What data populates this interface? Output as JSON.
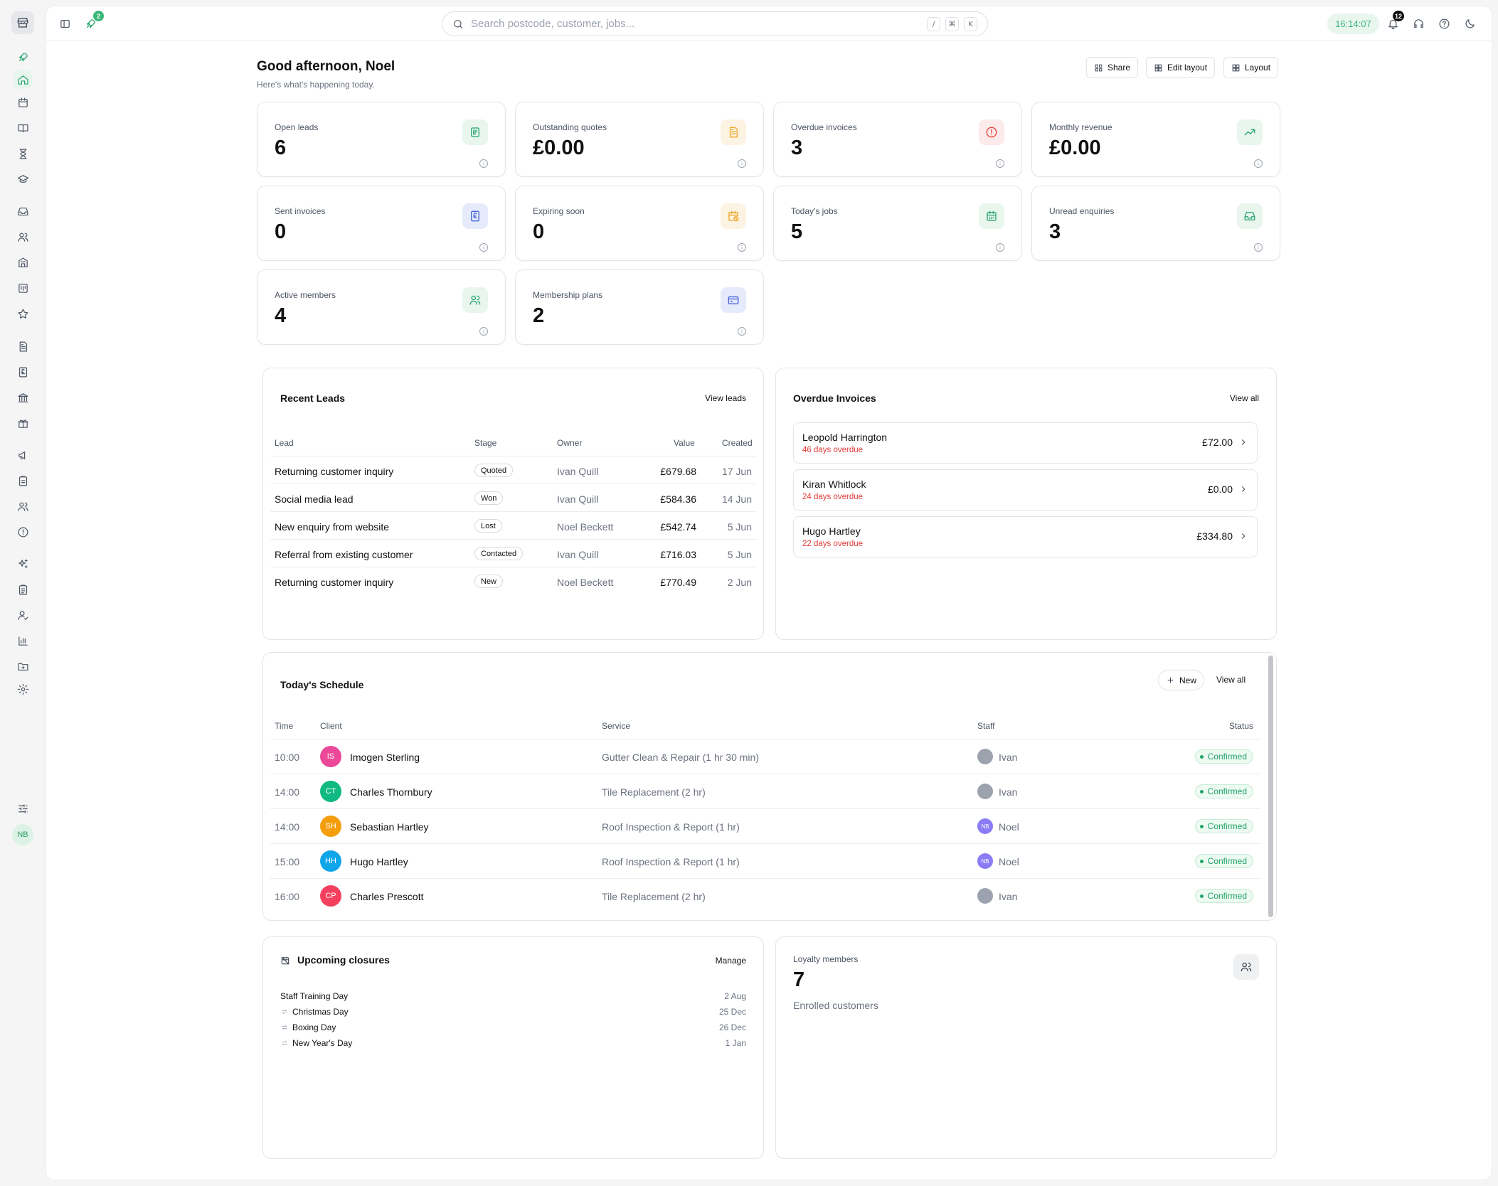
{
  "topbar": {
    "search_placeholder": "Search postcode, customer, jobs...",
    "kbd_slash": "/",
    "kbd_cmd": "⌘",
    "kbd_k": "K",
    "clock": "16:14:07",
    "rocket_badge": "2",
    "notification_badge": "12"
  },
  "header": {
    "greeting": "Good afternoon, Noel",
    "subtitle": "Here's what's happening today.",
    "share_label": "Share",
    "edit_layout_label": "Edit layout",
    "layout_label": "Layout"
  },
  "stats": [
    {
      "label": "Open leads",
      "value": "6",
      "icon": "clipboard-icon",
      "color": "#22a36a"
    },
    {
      "label": "Outstanding quotes",
      "value": "£0.00",
      "icon": "document-icon",
      "color": "#e9a21a"
    },
    {
      "label": "Overdue invoices",
      "value": "3",
      "icon": "alert-icon",
      "color": "#e23b3b"
    },
    {
      "label": "Monthly revenue",
      "value": "£0.00",
      "icon": "trend-up-icon",
      "color": "#22a36a"
    },
    {
      "label": "Sent invoices",
      "value": "0",
      "icon": "invoice-pound-icon",
      "color": "#3b5bdb"
    },
    {
      "label": "Expiring soon",
      "value": "0",
      "icon": "calendar-clock-icon",
      "color": "#e9a21a"
    },
    {
      "label": "Today's jobs",
      "value": "5",
      "icon": "calendar-icon",
      "color": "#22a36a"
    },
    {
      "label": "Unread enquiries",
      "value": "3",
      "icon": "inbox-icon",
      "color": "#22a36a"
    },
    {
      "label": "Active members",
      "value": "4",
      "icon": "users-icon",
      "color": "#22a36a"
    },
    {
      "label": "Membership plans",
      "value": "2",
      "icon": "credit-card-icon",
      "color": "#3b5bdb"
    }
  ],
  "recent_leads": {
    "title": "Recent Leads",
    "link": "View leads",
    "columns": [
      "Lead",
      "Stage",
      "Owner",
      "Value",
      "Created"
    ],
    "rows": [
      {
        "lead": "Returning customer inquiry",
        "stage": "Quoted",
        "owner": "Ivan Quill",
        "value": "£679.68",
        "created": "17 Jun"
      },
      {
        "lead": "Social media lead",
        "stage": "Won",
        "owner": "Ivan Quill",
        "value": "£584.36",
        "created": "14 Jun"
      },
      {
        "lead": "New enquiry from website",
        "stage": "Lost",
        "owner": "Noel Beckett",
        "value": "£542.74",
        "created": "5 Jun"
      },
      {
        "lead": "Referral from existing customer",
        "stage": "Contacted",
        "owner": "Ivan Quill",
        "value": "£716.03",
        "created": "5 Jun"
      },
      {
        "lead": "Returning customer inquiry",
        "stage": "New",
        "owner": "Noel Beckett",
        "value": "£770.49",
        "created": "2 Jun"
      }
    ]
  },
  "overdue_invoices": {
    "title": "Overdue Invoices",
    "link": "View all",
    "items": [
      {
        "name": "Leopold Harrington",
        "overdue": "46 days overdue",
        "amount": "£72.00"
      },
      {
        "name": "Kiran Whitlock",
        "overdue": "24 days overdue",
        "amount": "£0.00"
      },
      {
        "name": "Hugo Hartley",
        "overdue": "22 days overdue",
        "amount": "£334.80"
      }
    ]
  },
  "schedule": {
    "title": "Today's Schedule",
    "new_label": "New",
    "link": "View all",
    "columns": [
      "Time",
      "Client",
      "Service",
      "Staff",
      "Status"
    ],
    "rows": [
      {
        "time": "10:00",
        "initials": "IS",
        "color": "#ec4899",
        "client": "Imogen Sterling",
        "service": "Gutter Clean & Repair (1 hr 30 min)",
        "staff": "Ivan",
        "staff_initials": "",
        "status": "Confirmed"
      },
      {
        "time": "14:00",
        "initials": "CT",
        "color": "#10b981",
        "client": "Charles Thornbury",
        "service": "Tile Replacement (2 hr)",
        "staff": "Ivan",
        "staff_initials": "",
        "status": "Confirmed"
      },
      {
        "time": "14:00",
        "initials": "SH",
        "color": "#f59e0b",
        "client": "Sebastian Hartley",
        "service": "Roof Inspection & Report (1 hr)",
        "staff": "Noel",
        "staff_initials": "NB",
        "status": "Confirmed"
      },
      {
        "time": "15:00",
        "initials": "HH",
        "color": "#0ea5e9",
        "client": "Hugo Hartley",
        "service": "Roof Inspection & Report (1 hr)",
        "staff": "Noel",
        "staff_initials": "NB",
        "status": "Confirmed"
      },
      {
        "time": "16:00",
        "initials": "CP",
        "color": "#f43f5e",
        "client": "Charles Prescott",
        "service": "Tile Replacement (2 hr)",
        "staff": "Ivan",
        "staff_initials": "",
        "status": "Confirmed"
      }
    ]
  },
  "closures": {
    "title": "Upcoming closures",
    "link": "Manage",
    "items": [
      {
        "name": "Staff Training Day",
        "date": "2 Aug",
        "recurring": false
      },
      {
        "name": "Christmas Day",
        "date": "25 Dec",
        "recurring": true
      },
      {
        "name": "Boxing Day",
        "date": "26 Dec",
        "recurring": true
      },
      {
        "name": "New Year's Day",
        "date": "1 Jan",
        "recurring": true
      }
    ]
  },
  "loyalty": {
    "label": "Loyalty members",
    "value": "7",
    "caption": "Enrolled customers"
  },
  "user": {
    "initials": "NB"
  }
}
